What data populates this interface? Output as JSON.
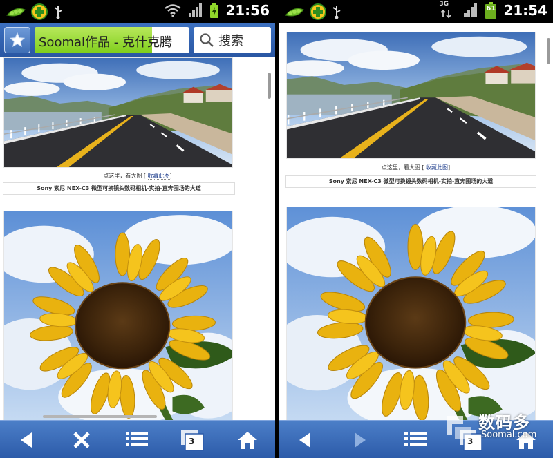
{
  "colors": {
    "toolbar": "#3b6fbe",
    "progress": "#8fd62a",
    "status_bar": "#000000"
  },
  "left": {
    "status_bar": {
      "time": "21:56"
    },
    "url_bar": {
      "page_title": "Soomal作品 - 克什克腾",
      "search_label": "搜索"
    },
    "article": {
      "photo1": {
        "name": "road-photo"
      },
      "caption_link_prefix": "点这里，看大图 [ ",
      "caption_link_fav": "收藏此图",
      "caption_link_suffix": "]",
      "caption_title": "Sony 索尼 NEX-C3 微型可换镜头数码相机-实拍-直奔围场的大道",
      "photo2": {
        "name": "sunflower-photo"
      }
    },
    "toolbar": {
      "tabs_count": "3",
      "icons": [
        "back-icon",
        "stop-icon",
        "menu-icon",
        "tabs-icon",
        "home-icon"
      ]
    }
  },
  "right": {
    "status_bar": {
      "time": "21:54",
      "network": "3G",
      "battery": "61"
    },
    "article": {
      "caption_link_prefix": "点这里，看大图 [ ",
      "caption_link_fav": "收藏此图",
      "caption_link_suffix": "]",
      "caption_title": "Sony 索尼 NEX-C3 微型可换镜头数码相机-实拍-直奔围场的大道"
    },
    "toolbar": {
      "tabs_count": "3",
      "icons": [
        "back-icon",
        "forward-icon",
        "menu-icon",
        "tabs-icon",
        "home-icon"
      ]
    }
  },
  "watermark": {
    "brand": "数码多",
    "domain": "Soomal.com"
  }
}
